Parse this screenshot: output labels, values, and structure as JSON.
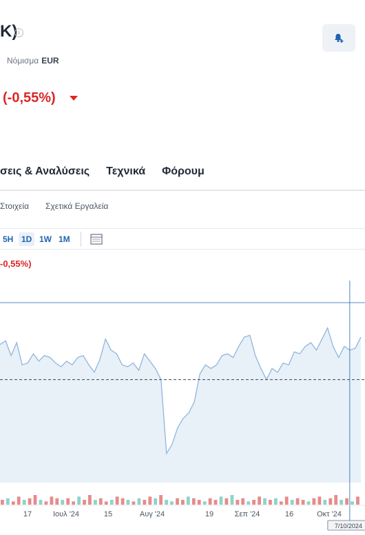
{
  "header": {
    "title_fragment": "K)",
    "info_icon": "i",
    "currency_label": "Νόμισμα",
    "currency_value": "EUR",
    "change_percent": "(-0,55%)",
    "change_direction": "down",
    "alert_icon": "bell-plus-icon"
  },
  "tabs": [
    {
      "label": "σεις & Αναλύσεις"
    },
    {
      "label": "Τεχνικά"
    },
    {
      "label": "Φόρουμ"
    }
  ],
  "subtabs": [
    {
      "label": "Στοιχεία"
    },
    {
      "label": "Σχετικά Εργαλεία"
    }
  ],
  "timeframes": [
    {
      "label": "5H",
      "active": false
    },
    {
      "label": "1D",
      "active": true
    },
    {
      "label": "1W",
      "active": false
    },
    {
      "label": "1M",
      "active": false
    }
  ],
  "chart_legend": {
    "change": "-0,55%)"
  },
  "colors": {
    "line": "#8fb6db",
    "area": "#e8f0f8",
    "negative": "#dc2626",
    "accent": "#1e63b0",
    "volume_up": "#8fd3c9",
    "volume_down": "#e88b8b"
  },
  "chart_data": {
    "type": "area",
    "x_tick_labels": [
      "17",
      "Ιουλ '24",
      "15",
      "Αυγ '24",
      "19",
      "Σεπ '24",
      "16",
      "Οκτ '24"
    ],
    "crosshair_label": "7/10/2024",
    "series": [
      {
        "values": [
          71,
          73,
          65,
          72,
          60,
          61,
          66,
          62,
          65,
          64,
          61,
          59,
          62,
          60,
          64,
          65,
          60,
          56,
          63,
          74,
          68,
          66,
          60,
          59,
          61,
          57,
          66,
          62,
          58,
          52,
          12,
          17,
          26,
          31,
          34,
          40,
          55,
          60,
          58,
          60,
          65,
          66,
          64,
          70,
          75,
          76,
          65,
          58,
          52,
          58,
          56,
          61,
          60,
          67,
          66,
          70,
          72,
          68,
          74,
          80,
          70,
          64,
          70,
          68,
          69,
          75
        ]
      }
    ],
    "reference_level": 52,
    "volume": {
      "values": [
        3,
        4,
        2,
        5,
        3,
        4,
        6,
        3,
        2,
        5,
        4,
        3,
        4,
        2,
        5,
        3,
        6,
        3,
        4,
        2,
        3,
        5,
        4,
        3,
        2,
        4,
        3,
        5,
        4,
        6,
        3,
        2,
        4,
        3,
        5,
        4,
        3,
        2,
        4,
        3,
        5,
        4,
        6,
        3,
        4,
        2,
        3,
        5,
        4,
        3,
        4,
        2,
        5,
        3,
        4,
        3,
        2,
        4,
        5,
        3,
        4,
        6,
        3,
        4,
        2,
        5
      ],
      "direction": [
        "d",
        "u",
        "d",
        "d",
        "u",
        "d",
        "d",
        "u",
        "d",
        "d",
        "d",
        "u",
        "d",
        "d",
        "u",
        "d",
        "d",
        "u",
        "d",
        "d",
        "u",
        "d",
        "d",
        "u",
        "d",
        "u",
        "d",
        "d",
        "u",
        "d",
        "u",
        "u",
        "d",
        "d",
        "u",
        "d",
        "d",
        "u",
        "d",
        "d",
        "u",
        "d",
        "u",
        "d",
        "d",
        "u",
        "d",
        "d",
        "u",
        "d",
        "u",
        "d",
        "d",
        "u",
        "d",
        "d",
        "u",
        "d",
        "d",
        "u",
        "d",
        "d",
        "u",
        "d",
        "u",
        "d"
      ]
    }
  }
}
